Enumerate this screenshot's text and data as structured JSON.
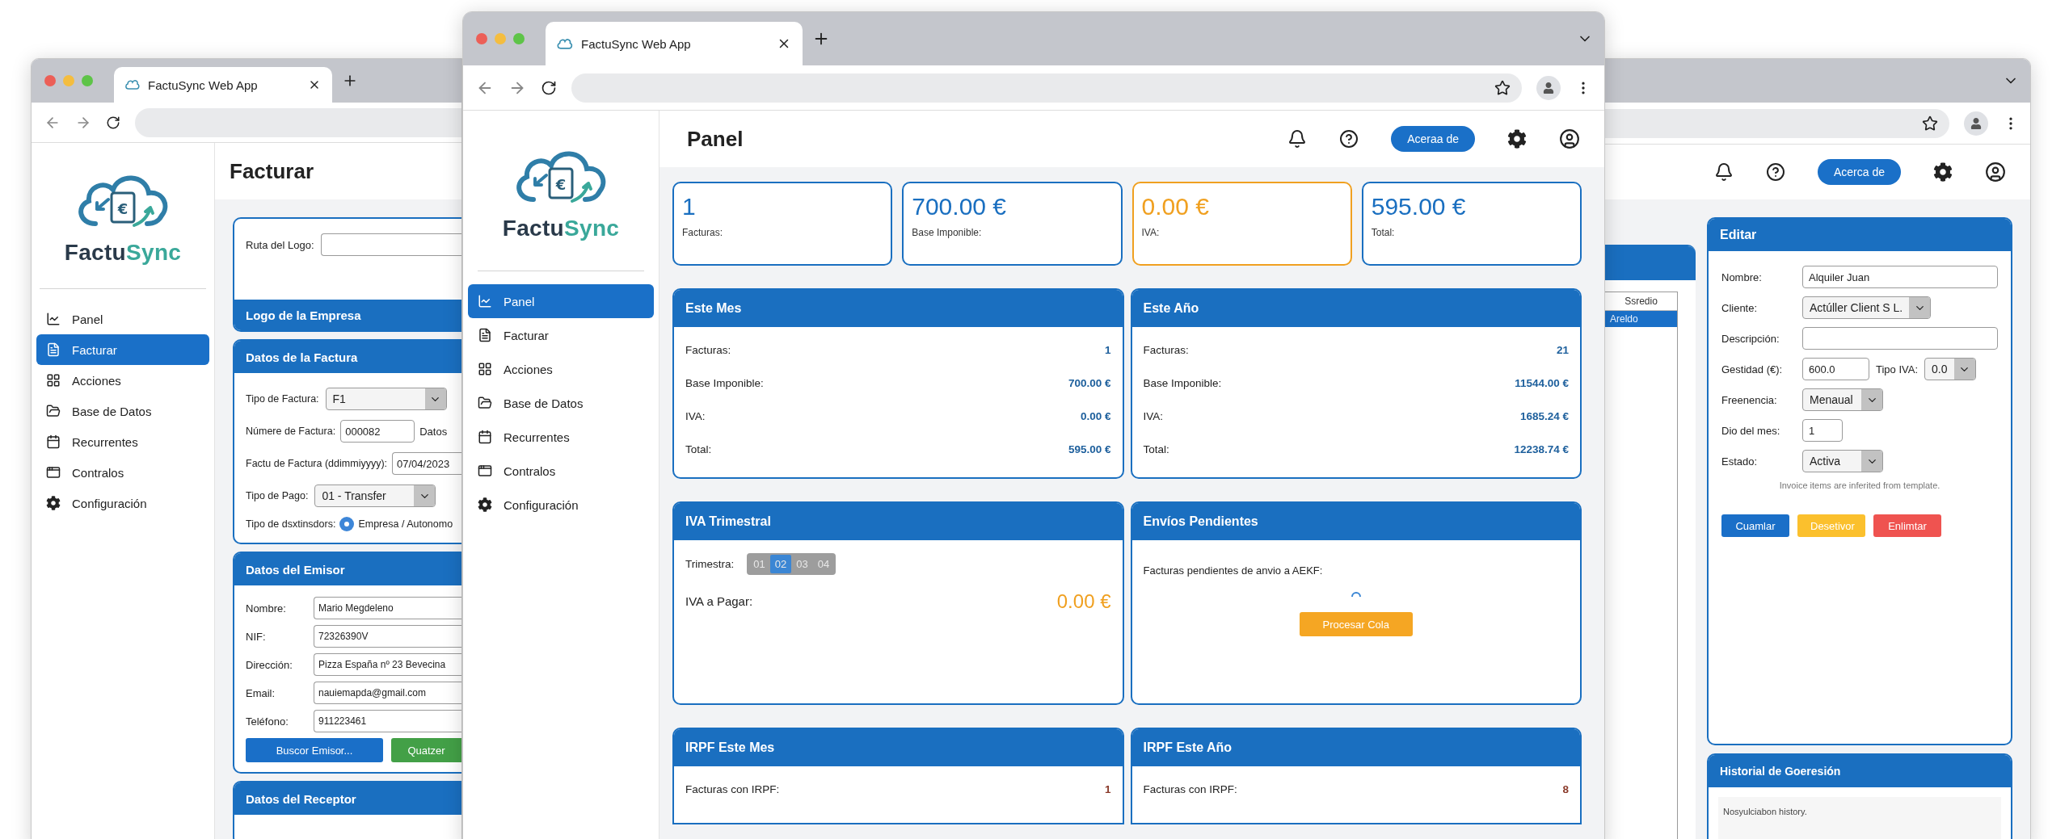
{
  "left_window": {
    "tab_title": "FactuSync Web App",
    "brand": {
      "first": "Factu",
      "second": "Sync",
      "symbol": "€"
    },
    "sidebar": [
      {
        "label": "Panel",
        "selected": false
      },
      {
        "label": "Facturar",
        "selected": true
      },
      {
        "label": "Acciones",
        "selected": false
      },
      {
        "label": "Base de Datos",
        "selected": false
      },
      {
        "label": "Recurrentes",
        "selected": false
      },
      {
        "label": "Contralos",
        "selected": false
      },
      {
        "label": "Configuración",
        "selected": false
      }
    ],
    "page_title": "Facturar",
    "logo_card": {
      "label": "Ruta del Logo:",
      "footer": "Logo de la Empresa"
    },
    "sections": [
      {
        "kind": "form",
        "title": "Datos de la Factura",
        "rows": [
          {
            "kind": "select",
            "label": "Tipo de Factura:",
            "value": "F1"
          },
          {
            "kind": "input",
            "label": "Númere de Factura:",
            "value": "000082",
            "aside": "Datos"
          },
          {
            "kind": "input",
            "label": "Factu de Factura (ddimmiyyyy):",
            "value": "07/04/2023"
          },
          {
            "kind": "select",
            "label": "Tipo de Pago:",
            "value": "01 - Transfer"
          },
          {
            "kind": "radio",
            "label": "Tipo de dsxtinsdors:",
            "value": "Empresa / Autonomo",
            "selected": true
          }
        ]
      },
      {
        "kind": "aligned_form",
        "title": "Datos del Emisor",
        "rows": [
          {
            "kind": "input",
            "label": "Nombre:",
            "value": "Mario Megdeleno"
          },
          {
            "kind": "input",
            "label": "NIF:",
            "value": "72326390V"
          },
          {
            "kind": "input",
            "label": "Dirección:",
            "value": "Pizza España nº 23 Bevecina"
          },
          {
            "kind": "input",
            "label": "Email:",
            "value": "nauiemapda@gmail.com"
          },
          {
            "kind": "input",
            "label": "Teléfono:",
            "value": "911223461"
          }
        ],
        "buttons": [
          {
            "label": "Buscor Emisor...",
            "color": "#1a6fc8"
          },
          {
            "label": "Quatzer",
            "color": "#43a047"
          }
        ]
      },
      {
        "kind": "header_only",
        "title": "Datos del Receptor"
      }
    ]
  },
  "center_window": {
    "tab_title": "FactuSync Web App",
    "brand": {
      "first": "Factu",
      "second": "Sync",
      "symbol": "€"
    },
    "sidebar": [
      {
        "label": "Panel",
        "selected": true
      },
      {
        "label": "Facturar",
        "selected": false
      },
      {
        "label": "Acciones",
        "selected": false
      },
      {
        "label": "Base de Datos",
        "selected": false
      },
      {
        "label": "Recurrentes",
        "selected": false
      },
      {
        "label": "Contralos",
        "selected": false
      },
      {
        "label": "Configuración",
        "selected": false
      }
    ],
    "page_title": "Panel",
    "header_button": "Aceraa de",
    "stats": [
      {
        "value": "1",
        "label": "Facturas:",
        "color": "#1a6fc0"
      },
      {
        "value": "700.00 €",
        "label": "Base Imponible:",
        "color": "#1a6fc0"
      },
      {
        "value": "0.00 €",
        "label": "IVA:",
        "color": "#f0a020"
      },
      {
        "value": "595.00 €",
        "label": "Total:",
        "color": "#1a6fc0"
      }
    ],
    "summaries": [
      {
        "title": "Este Mes",
        "rows": [
          {
            "label": "Facturas:",
            "value": "1"
          },
          {
            "label": "Base Imponible:",
            "value": "700.00 €"
          },
          {
            "label": "IVA:",
            "value": "0.00 €"
          },
          {
            "label": "Total:",
            "value": "595.00 €"
          }
        ]
      },
      {
        "title": "Este Año",
        "rows": [
          {
            "label": "Facturas:",
            "value": "21"
          },
          {
            "label": "Base Imponible:",
            "value": "11544.00 €"
          },
          {
            "label": "IVA:",
            "value": "1685.24 €"
          },
          {
            "label": "Total:",
            "value": "12238.74 €"
          }
        ]
      }
    ],
    "quarterly": {
      "title": "IVA Trimestral",
      "label": "Trimestra:",
      "quarters": [
        {
          "label": "01",
          "selected": false
        },
        {
          "label": "02",
          "selected": true
        },
        {
          "label": "03",
          "selected": false
        },
        {
          "label": "04",
          "selected": false
        }
      ],
      "due_label": "IVA a Pagar:",
      "due_value": "0.00 €"
    },
    "pending": {
      "title": "Envíos Pendientes",
      "text": "Facturas pendientes de anvio a AEKF:",
      "button": "Procesar Cola"
    },
    "irpf": [
      {
        "title": "IRPF Este Mes",
        "rows": [
          {
            "label": "Facturas con IRPF:",
            "value": "1"
          }
        ]
      },
      {
        "title": "IRPF Este Año",
        "rows": [
          {
            "label": "Facturas con IRPF:",
            "value": "8"
          }
        ]
      }
    ]
  },
  "right_window": {
    "header_button": "Acerca de",
    "list": {
      "header": "Ssredio",
      "items": [
        {
          "label": "Areldo",
          "selected": true
        }
      ]
    },
    "editor": {
      "title": "Editar",
      "rows": [
        {
          "kind": "input",
          "label": "Nombre:",
          "value": "Alquiler Juan"
        },
        {
          "kind": "select",
          "label": "Cliente:",
          "value": "Actúller Client S L."
        },
        {
          "kind": "input",
          "label": "Descripción:"
        },
        {
          "kind": "pair",
          "label": "Gestidad (€):",
          "value": "600.0",
          "second_label": "Tipo IVA:",
          "second_value": "0.0"
        },
        {
          "kind": "select",
          "label": "Freenencia:",
          "value": "Menaual"
        },
        {
          "kind": "short_input",
          "label": "Dio del mes:",
          "value": "1"
        },
        {
          "kind": "select",
          "label": "Estado:",
          "value": "Activa"
        }
      ],
      "note": "Invoice items are inferited from template.",
      "buttons": [
        {
          "label": "Cuamlar",
          "color": "#1a6fc8"
        },
        {
          "label": "Desetivor",
          "color": "#fbc02d"
        },
        {
          "label": "Enlimtar",
          "color": "#ef5350"
        }
      ]
    },
    "history": {
      "title": "Historial de Goeresión",
      "text": "Nosyulciabon history."
    }
  }
}
